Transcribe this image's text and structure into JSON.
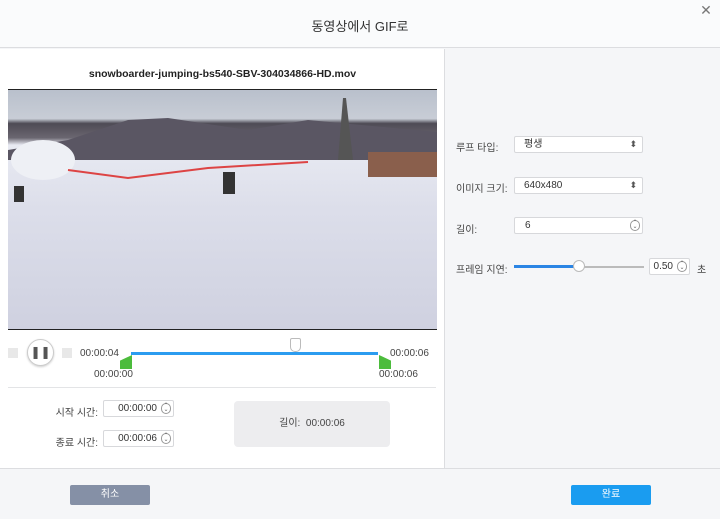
{
  "dialog": {
    "title": "동영상에서 GIF로",
    "close_icon": "close-icon"
  },
  "video": {
    "filename": "snowboarder-jumping-bs540-SBV-304034866-HD.mov"
  },
  "player": {
    "current_time": "00:00:04",
    "end_time_top": "00:00:06",
    "trim_start": "00:00:00",
    "trim_end": "00:00:06",
    "play_state": "paused",
    "playhead_fraction": 0.67
  },
  "trim": {
    "start_label": "시작 시간:",
    "start_value": "00:00:00",
    "end_label": "종료 시간:",
    "end_value": "00:00:06",
    "length_label": "길이:",
    "length_value": "00:00:06"
  },
  "settings": {
    "loop_label": "루프 타입:",
    "loop_value": "평생",
    "size_label": "이미지 크기:",
    "size_value": "640x480",
    "length_label": "길이:",
    "length_value": "6",
    "delay_label": "프레임 지연:",
    "delay_value": "0.50",
    "delay_unit": "초",
    "delay_fraction": 0.5
  },
  "footer": {
    "cancel": "취소",
    "done": "완료"
  },
  "colors": {
    "accent": "#2b9cf0",
    "done_button": "#1a9cf0",
    "cancel_button": "#8590a6",
    "trim_flag": "#4cbc3c"
  }
}
